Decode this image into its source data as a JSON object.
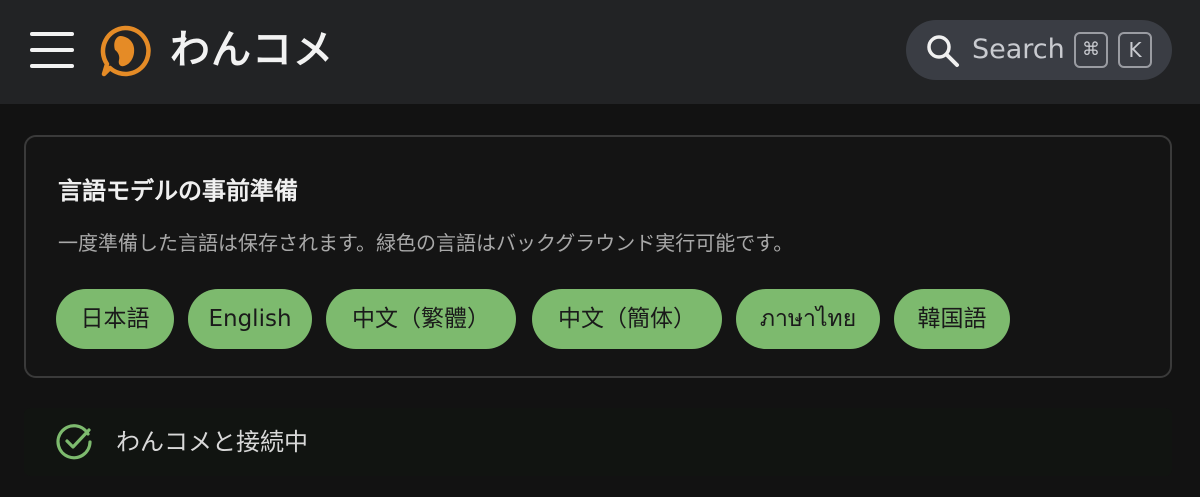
{
  "header": {
    "brand": "わんコメ",
    "search_label": "Search",
    "shortcut_keys": [
      "⌘",
      "K"
    ]
  },
  "language_card": {
    "title": "言語モデルの事前準備",
    "description": "一度準備した言語は保存されます。緑色の言語はバックグラウンド実行可能です。",
    "chips": [
      "日本語",
      "English",
      "中文（繁體）",
      "中文（簡体）",
      "ภาษาไทย",
      "韓国語"
    ]
  },
  "status": {
    "text": "わんコメと接続中"
  },
  "colors": {
    "chip_green": "#7dba6e",
    "logo_orange": "#e58b26",
    "check_green": "#7dba6e"
  }
}
